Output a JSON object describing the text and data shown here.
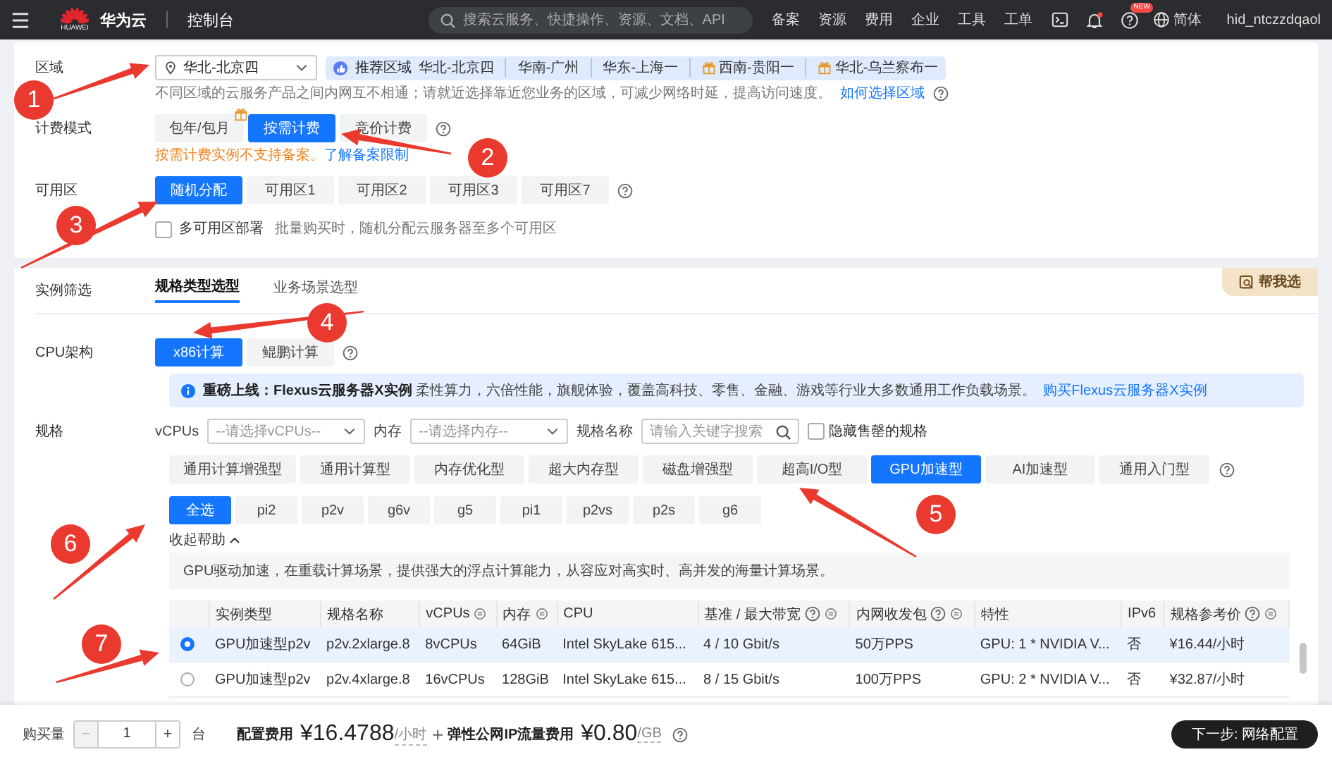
{
  "top_bar": {
    "logo_text": "HUAWEI",
    "brand": "华为云",
    "console": "控制台",
    "search": {
      "placeholder": "搜索云服务、快捷操作、资源、文档、API"
    },
    "nav": [
      "备案",
      "资源",
      "费用",
      "企业",
      "工具",
      "工单"
    ],
    "help_badge": "NEW",
    "language": "简体",
    "user": "hid_ntczzdqaol"
  },
  "region": {
    "label": "区域",
    "select": {
      "value": "华北-北京四"
    },
    "recommended": {
      "label": "推荐区域",
      "items": [
        {
          "name": "华北-北京四",
          "gift": false
        },
        {
          "name": "华南-广州",
          "gift": false
        },
        {
          "name": "华东-上海一",
          "gift": false
        },
        {
          "name": "西南-贵阳一",
          "gift": true
        },
        {
          "name": "华北-乌兰察布一",
          "gift": true
        }
      ]
    },
    "hint": "不同区域的云服务产品之间内网互不相通；请就近选择靠近您业务的区域，可减少网络时延，提高访问速度。",
    "hint_link": "如何选择区域"
  },
  "billing": {
    "label": "计费模式",
    "options": [
      {
        "label": "包年/包月",
        "selected": false,
        "gift": true
      },
      {
        "label": "按需计费",
        "selected": true,
        "gift": false
      },
      {
        "label": "竞价计费",
        "selected": false,
        "gift": false
      }
    ],
    "warning": "按需计费实例不支持备案。",
    "warning_link": "了解备案限制"
  },
  "availability_zone": {
    "label": "可用区",
    "options": [
      {
        "label": "随机分配",
        "selected": true
      },
      {
        "label": "可用区1",
        "selected": false
      },
      {
        "label": "可用区2",
        "selected": false
      },
      {
        "label": "可用区3",
        "selected": false
      },
      {
        "label": "可用区7",
        "selected": false
      }
    ],
    "multi_az": {
      "label": "多可用区部署",
      "checked": false,
      "hint": "批量购买时，随机分配云服务器至多个可用区"
    }
  },
  "instance_filter": {
    "label": "实例筛选",
    "tabs": [
      {
        "label": "规格类型选型",
        "selected": true
      },
      {
        "label": "业务场景选型",
        "selected": false
      }
    ],
    "help_button": "帮我选"
  },
  "cpu_arch": {
    "label": "CPU架构",
    "options": [
      {
        "label": "x86计算",
        "selected": true
      },
      {
        "label": "鲲鹏计算",
        "selected": false
      }
    ]
  },
  "banner": {
    "text": "**重磅上线：Flexus云服务器X实例** 柔性算力，六倍性能，旗舰体验，覆盖高科技、零售、金融、游戏等行业大多数通用工作负载场景。",
    "link": "购买Flexus云服务器X实例"
  },
  "spec": {
    "label": "规格",
    "vcpus_label": "vCPUs",
    "vcpus_placeholder": "--请选择vCPUs--",
    "memory_label": "内存",
    "memory_placeholder": "--请选择内存--",
    "name_label": "规格名称",
    "name_placeholder": "请输入关键字搜索",
    "hide_sold_out": {
      "label": "隐藏售罄的规格",
      "checked": false
    },
    "types": [
      {
        "label": "通用计算增强型",
        "selected": false
      },
      {
        "label": "通用计算型",
        "selected": false
      },
      {
        "label": "内存优化型",
        "selected": false
      },
      {
        "label": "超大内存型",
        "selected": false
      },
      {
        "label": "磁盘增强型",
        "selected": false
      },
      {
        "label": "超高I/O型",
        "selected": false
      },
      {
        "label": "GPU加速型",
        "selected": true
      },
      {
        "label": "AI加速型",
        "selected": false
      },
      {
        "label": "通用入门型",
        "selected": false
      }
    ],
    "series": [
      {
        "label": "全选",
        "selected": true
      },
      {
        "label": "pi2",
        "selected": false
      },
      {
        "label": "p2v",
        "selected": false
      },
      {
        "label": "g6v",
        "selected": false
      },
      {
        "label": "g5",
        "selected": false
      },
      {
        "label": "pi1",
        "selected": false
      },
      {
        "label": "p2vs",
        "selected": false
      },
      {
        "label": "p2s",
        "selected": false
      },
      {
        "label": "g6",
        "selected": false
      }
    ],
    "collapse_help": "收起帮助",
    "description": "GPU驱动加速，在重载计算场景，提供强大的浮点计算能力，从容应对高实时、高并发的海量计算场景。"
  },
  "table": {
    "columns": [
      {
        "label": "实例类型",
        "help": false,
        "sort": false
      },
      {
        "label": "规格名称",
        "help": false,
        "sort": false
      },
      {
        "label": "vCPUs",
        "help": false,
        "sort": true
      },
      {
        "label": "内存",
        "help": false,
        "sort": true
      },
      {
        "label": "CPU",
        "help": false,
        "sort": false
      },
      {
        "label": "基准 / 最大带宽",
        "help": true,
        "sort": true
      },
      {
        "label": "内网收发包",
        "help": true,
        "sort": true
      },
      {
        "label": "特性",
        "help": false,
        "sort": false
      },
      {
        "label": "IPv6",
        "help": false,
        "sort": false
      },
      {
        "label": "规格参考价",
        "help": true,
        "sort": true
      }
    ],
    "rows": [
      {
        "selected": true,
        "cells": [
          "GPU加速型p2v",
          "p2v.2xlarge.8",
          "8vCPUs",
          "64GiB",
          "Intel SkyLake 615...",
          "4 / 10 Gbit/s",
          "50万PPS",
          "GPU: 1 * NVIDIA V...",
          "否",
          "¥16.44/小时"
        ]
      },
      {
        "selected": false,
        "cells": [
          "GPU加速型p2v",
          "p2v.4xlarge.8",
          "16vCPUs",
          "128GiB",
          "Intel SkyLake 615...",
          "8 / 15 Gbit/s",
          "100万PPS",
          "GPU: 2 * NVIDIA V...",
          "否",
          "¥32.87/小时"
        ]
      }
    ]
  },
  "footer": {
    "quantity_label": "购买量",
    "decrement": "−",
    "quantity": "1",
    "increment": "+",
    "unit": "台",
    "config_fee_label": "配置费用",
    "config_fee": "¥16.4788",
    "config_fee_unit": "/小时",
    "plus": "+",
    "ip_fee_label": "弹性公网IP流量费用",
    "ip_fee": "¥0.80",
    "ip_fee_unit": "/GB",
    "next_button": "下一步: 网络配置"
  },
  "annotations": [
    {
      "number": "1"
    },
    {
      "number": "2"
    },
    {
      "number": "3"
    },
    {
      "number": "4"
    },
    {
      "number": "5"
    },
    {
      "number": "6"
    },
    {
      "number": "7"
    }
  ]
}
